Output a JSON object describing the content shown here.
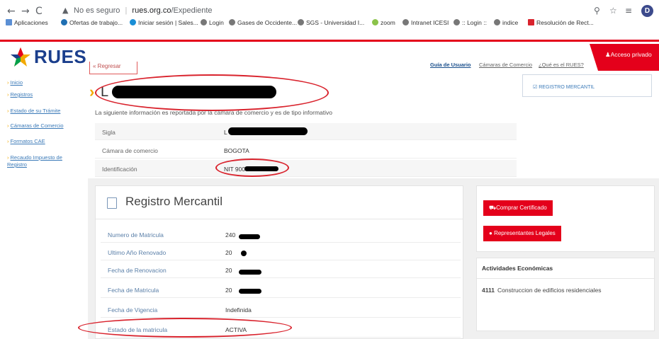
{
  "browser": {
    "security_warning": "No es seguro",
    "url_host": "rues.org.co",
    "url_path": "/Expediente",
    "profile_initial": "D",
    "bookmarks": [
      "Aplicaciones",
      "Ofertas de trabajo...",
      "Iniciar sesión | Sales...",
      "Login",
      "Gases de Occidente...",
      "SGS - Universidad I...",
      "zoom",
      "Intranet ICESI",
      ":: Login ::",
      "indice",
      "Resolución de Rect..."
    ]
  },
  "site": {
    "logo": "RUES",
    "sidebar": [
      "Inicio",
      "Registros",
      "Estado de su Trámite",
      "Cámaras de Comercio",
      "Formatos CAE",
      "Recaudo Impuesto de Registro"
    ],
    "header_links": [
      "Guía de Usuario",
      "Cámaras de Comercio",
      "¿Qué es el RUES?"
    ],
    "access_button": "Acceso privado"
  },
  "expediente": {
    "back_button": "« Regresar",
    "title_initial": "L",
    "registry_badge": "REGISTRO MERCANTIL",
    "info_text": "La siguiente información es reportada por la cámara de comercio y es de tipo informativo",
    "rows": [
      {
        "label": "Sigla",
        "value": "L"
      },
      {
        "label": "Cámara de comercio",
        "value": "BOGOTA"
      },
      {
        "label": "Identificación",
        "value": "NIT 900"
      }
    ]
  },
  "registro_mercantil": {
    "title": "Registro Mercantil",
    "rows": [
      {
        "label": "Numero de Matricula",
        "value": "240"
      },
      {
        "label": "Ultimo Año Renovado",
        "value": "20"
      },
      {
        "label": "Fecha de Renovacion",
        "value": "20"
      },
      {
        "label": "Fecha de Matricula",
        "value": "20"
      },
      {
        "label": "Fecha de Vigencia",
        "value": "Indefinida"
      },
      {
        "label": "Estado de la matricula",
        "value": "ACTIVA"
      }
    ]
  },
  "actions": {
    "buy_certificate": "Comprar Certificado",
    "legal_reps": "Representantes Legales"
  },
  "actividades": {
    "title": "Actividades Económicas",
    "items": [
      {
        "code": "4111",
        "desc": "Construccion de edificios residenciales"
      }
    ]
  }
}
